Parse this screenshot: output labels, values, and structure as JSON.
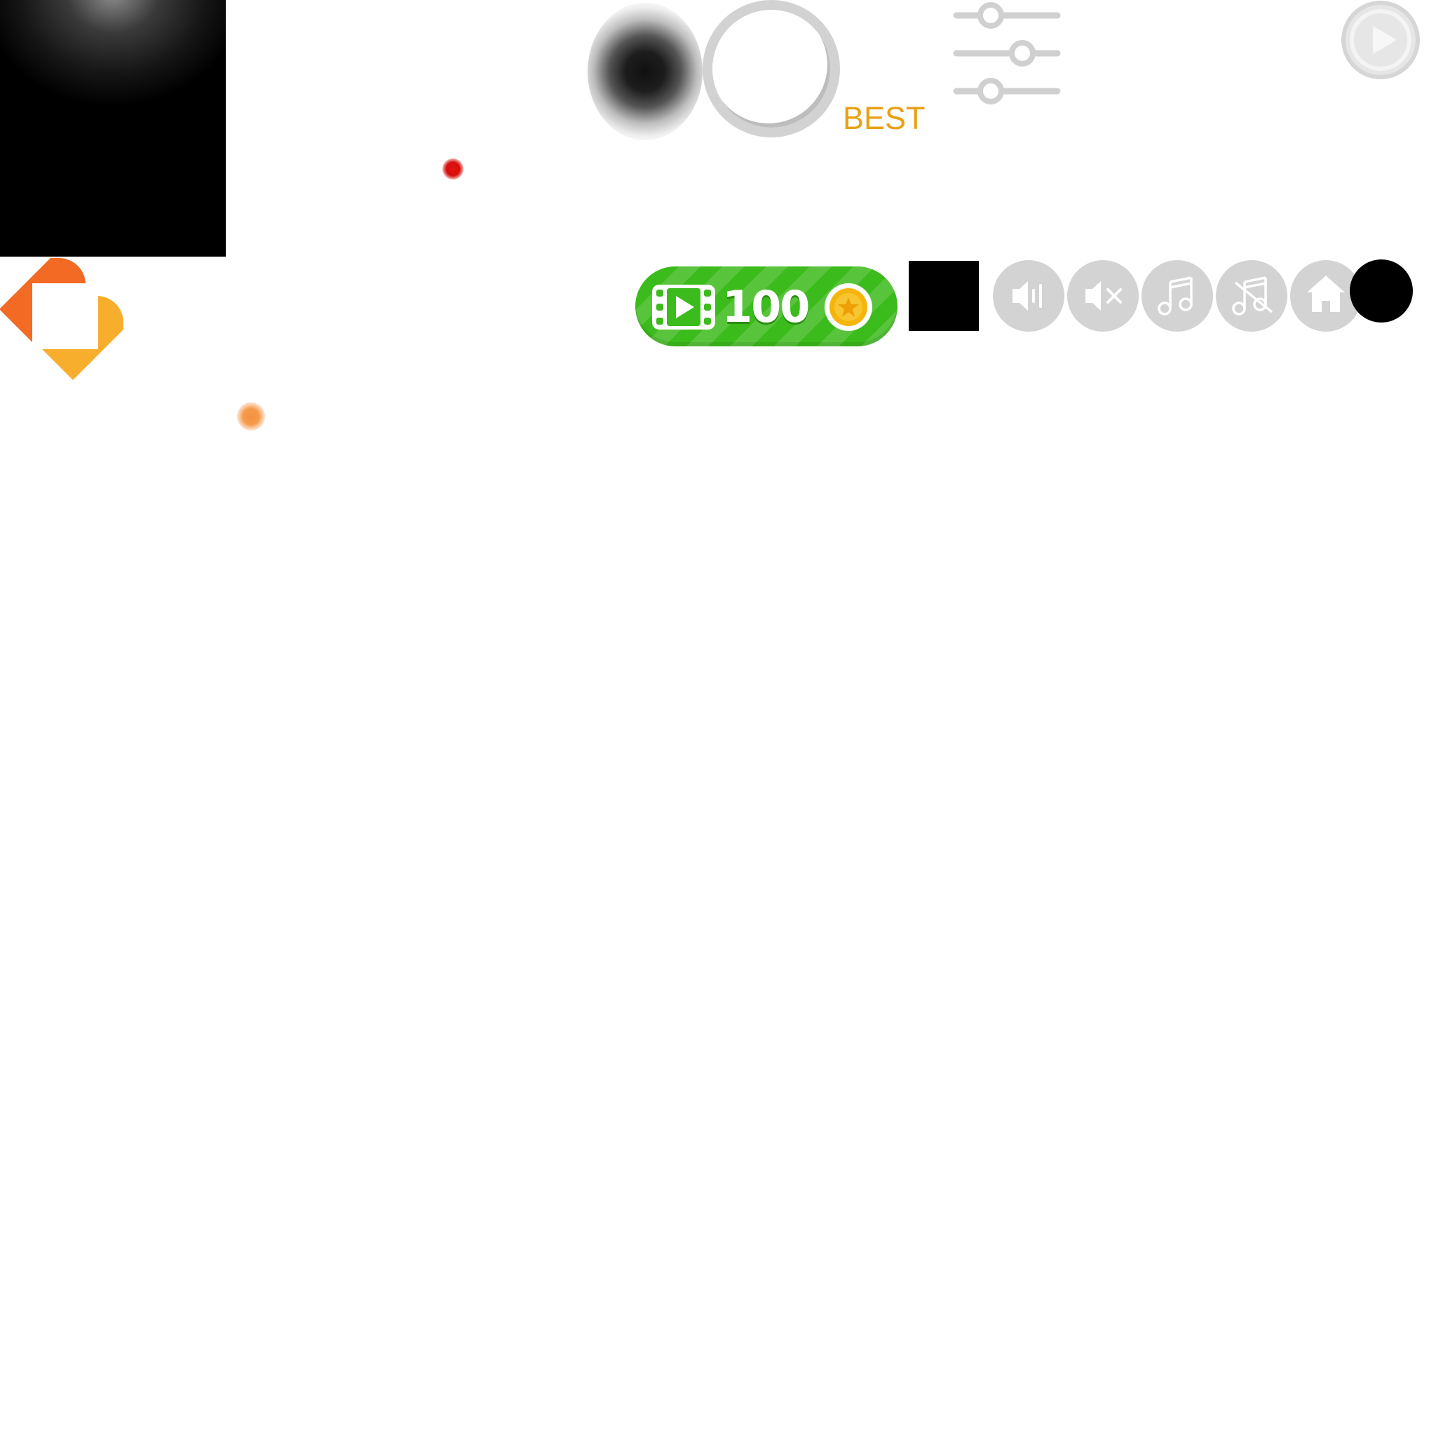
{
  "hud": {
    "best_label": "BEST"
  },
  "reward": {
    "amount": "100",
    "video_icon": "film-play-icon",
    "currency_icon": "gold-coin-star-icon"
  },
  "controls": {
    "settings_icon": "sliders-icon",
    "play_icon": "play-circle-icon",
    "sound_on_icon": "speaker-on-icon",
    "sound_off_icon": "speaker-mute-icon",
    "music_on_icon": "music-note-icon",
    "music_off_icon": "music-off-icon",
    "home_icon": "home-icon"
  },
  "colors": {
    "best_text": "#e8a114",
    "reward_green": "#3cbb1c",
    "button_gray": "#d3d3d3",
    "icon_white": "#ffffff",
    "coin_gold": "#f5b50c",
    "logo_orange": "#f26a24",
    "logo_yellow": "#f7ae2d"
  }
}
